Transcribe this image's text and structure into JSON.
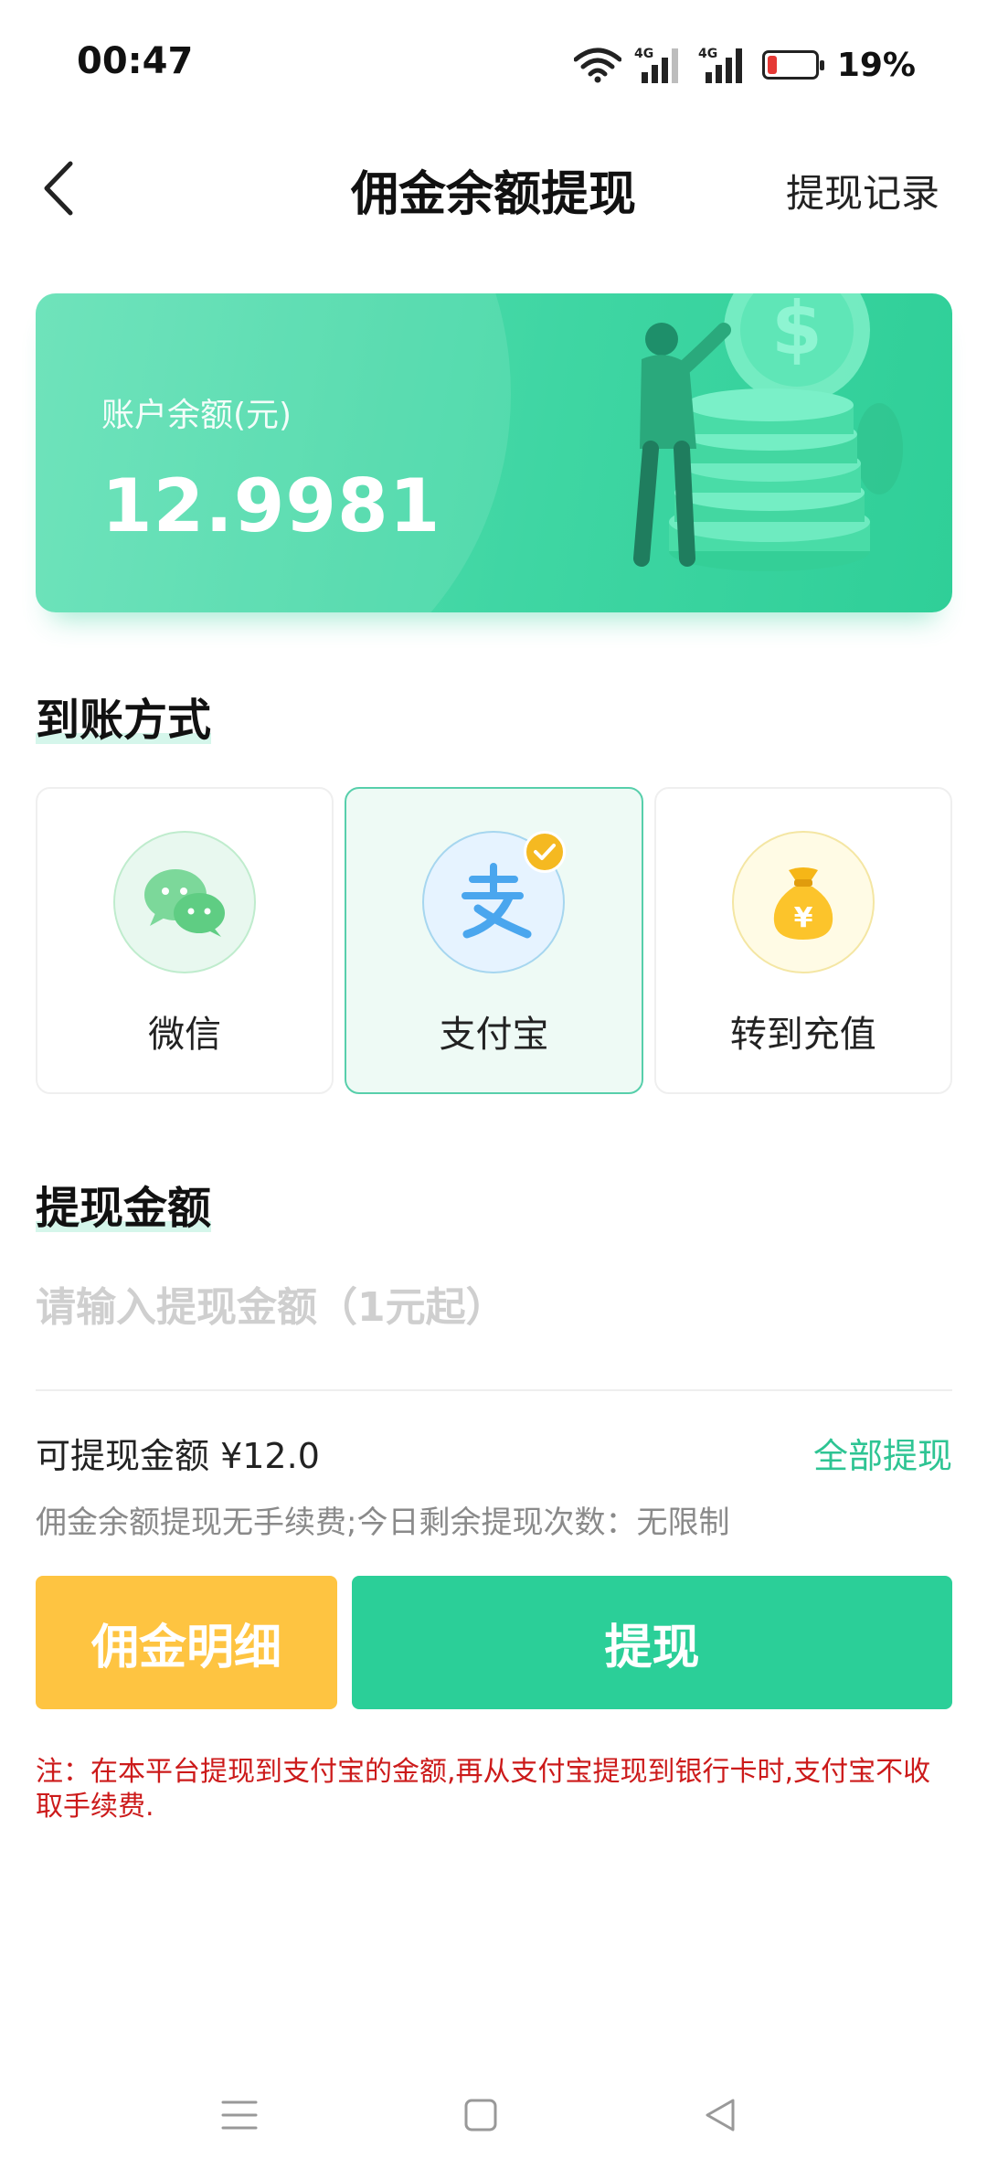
{
  "status_bar": {
    "time": "00:47",
    "network_1": "4G",
    "network_2": "4G",
    "battery": "19%"
  },
  "nav": {
    "title": "佣金余额提现",
    "history_label": "提现记录"
  },
  "balance_card": {
    "label": "账户余额(元)",
    "value": "12.9981"
  },
  "payment": {
    "section_title": "到账方式",
    "methods": [
      {
        "label": "微信",
        "icon": "wechat-icon",
        "selected": false
      },
      {
        "label": "支付宝",
        "icon": "alipay-icon",
        "selected": true
      },
      {
        "label": "转到充值",
        "icon": "money-bag-icon",
        "selected": false
      }
    ]
  },
  "amount": {
    "section_title": "提现金额",
    "placeholder": "请输入提现金额（1元起）",
    "value": "",
    "available_label": "可提现金额 ¥12.0",
    "withdraw_all_label": "全部提现",
    "fee_note": "佣金余额提现无手续费;今日剩余提现次数：无限制"
  },
  "buttons": {
    "detail_label": "佣金明细",
    "withdraw_label": "提现"
  },
  "notice": "注：在本平台提现到支付宝的金额,再从支付宝提现到银行卡时,支付宝不收取手续费.",
  "colors": {
    "primary_green": "#2bcf98",
    "accent_yellow": "#fec441",
    "notice_red": "#cc1a1a",
    "battery_low": "#e53935"
  }
}
